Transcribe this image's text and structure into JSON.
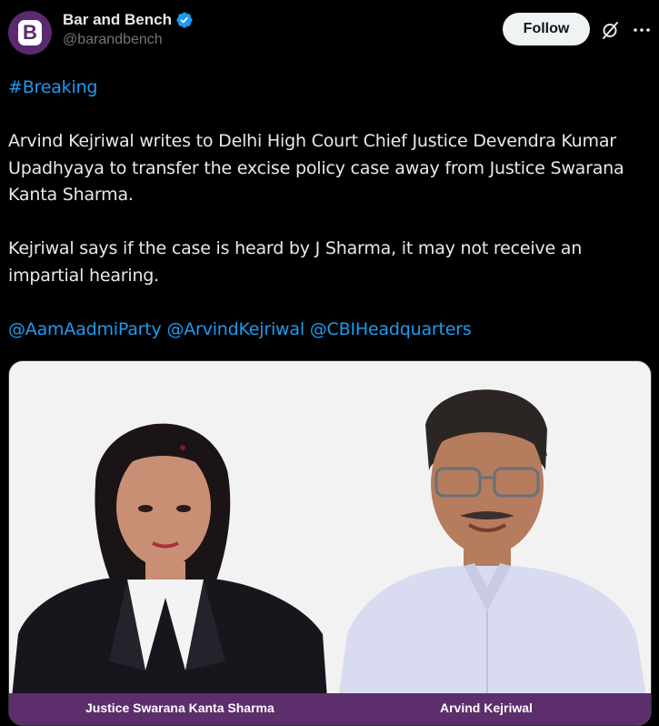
{
  "account": {
    "display_name": "Bar and Bench",
    "handle": "@barandbench",
    "avatar_letter": "B",
    "avatar_color": "#5a2a70",
    "verified": true
  },
  "actions": {
    "follow_label": "Follow",
    "grok_icon": "grok-icon",
    "more_icon": "more-icon"
  },
  "tweet": {
    "hashtag": "#Breaking",
    "paragraph1": "Arvind Kejriwal writes to Delhi High Court Chief Justice Devendra Kumar Upadhyaya to transfer the excise policy case away from Justice Swarana Kanta Sharma.",
    "paragraph2": "Kejriwal says if the case is heard by J Sharma, it may not receive an impartial hearing.",
    "mentions": [
      "@AamAadmiParty",
      "@ArvindKejriwal",
      "@CBIHeadquarters"
    ]
  },
  "media": {
    "caption_left": "Justice Swarana Kanta Sharma",
    "caption_right": "Arvind Kejriwal",
    "caption_bar_color": "#5c2e6c"
  },
  "colors": {
    "background": "#000000",
    "text": "#e7e9ea",
    "secondary": "#71767b",
    "link": "#1d9bf0",
    "verified": "#1d9bf0"
  }
}
